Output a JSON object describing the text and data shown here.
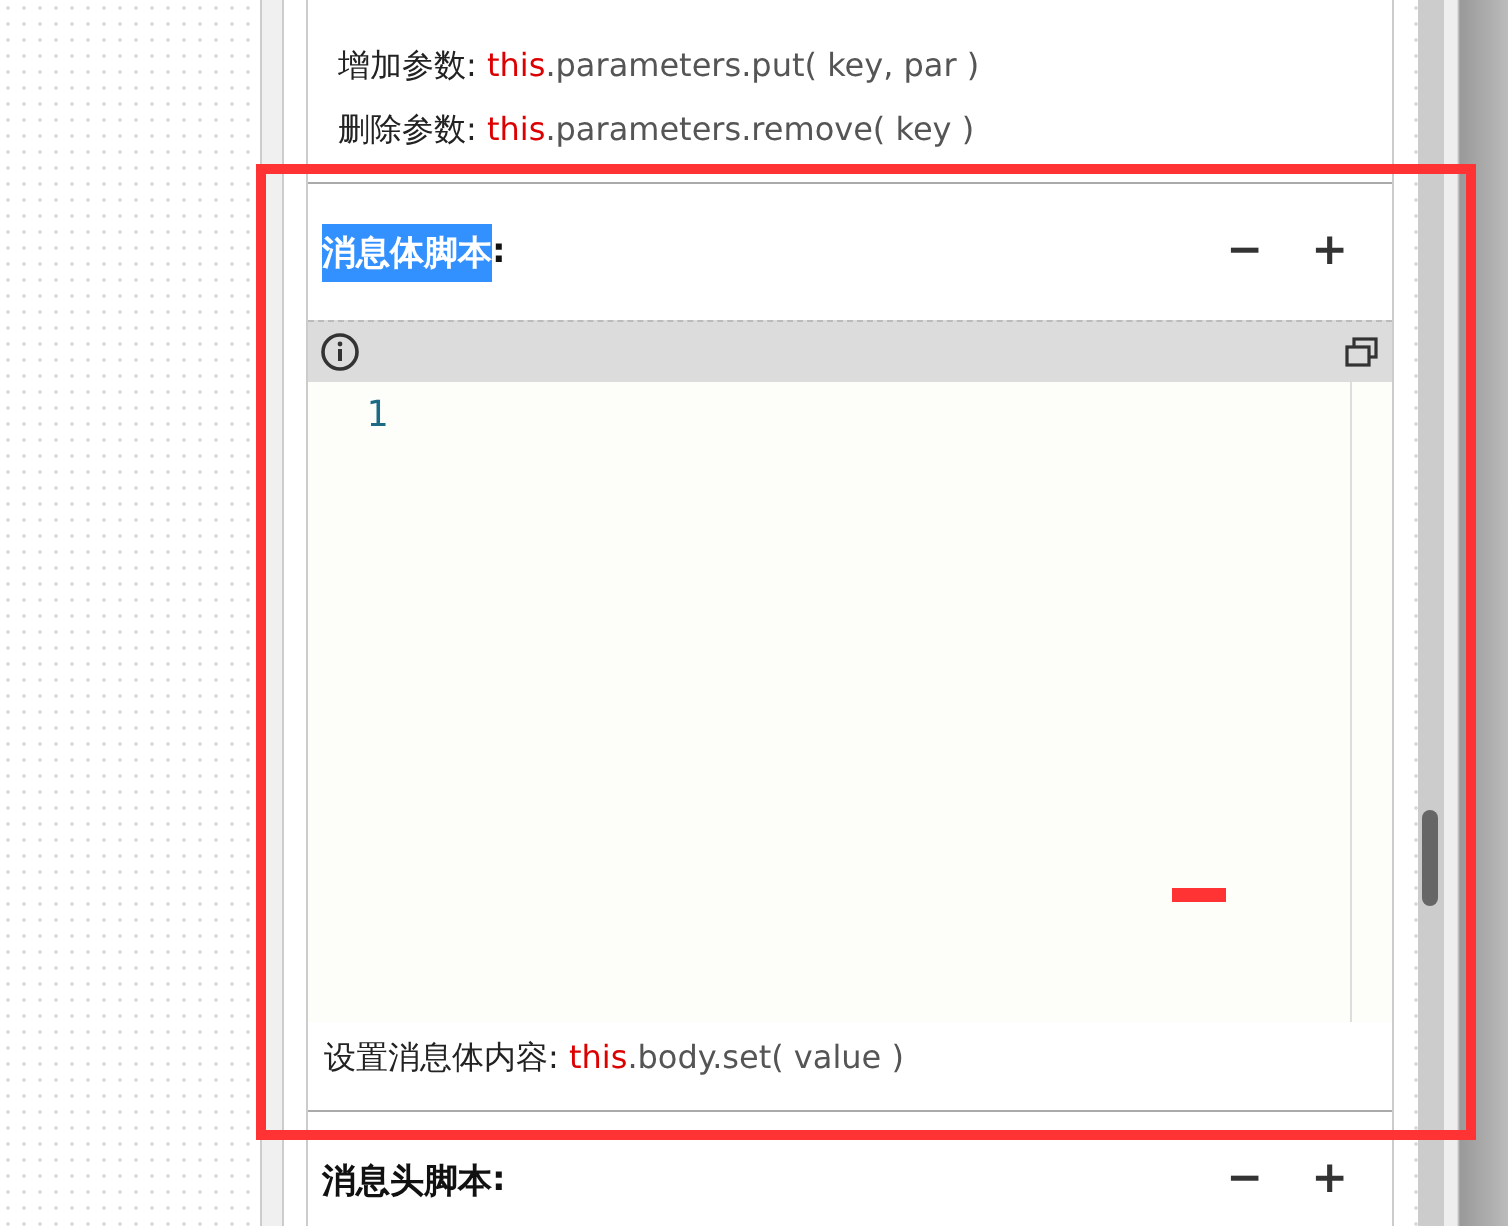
{
  "top_hints": [
    {
      "label": "增加参数: ",
      "keyword": "this",
      "code": ".parameters.put( key, par )"
    },
    {
      "label": "删除参数: ",
      "keyword": "this",
      "code": ".parameters.remove( key )"
    }
  ],
  "sections": [
    {
      "title": "消息体脚本",
      "suffix": ":",
      "highlighted": true,
      "collapse": "−",
      "expand": "+",
      "editor": {
        "line_numbers": [
          "1"
        ]
      },
      "hint": {
        "label": "设置消息体内容: ",
        "keyword": "this",
        "code": ".body.set( value )"
      }
    },
    {
      "title": "消息头脚本",
      "suffix": ":",
      "highlighted": false,
      "collapse": "−",
      "expand": "+"
    }
  ]
}
